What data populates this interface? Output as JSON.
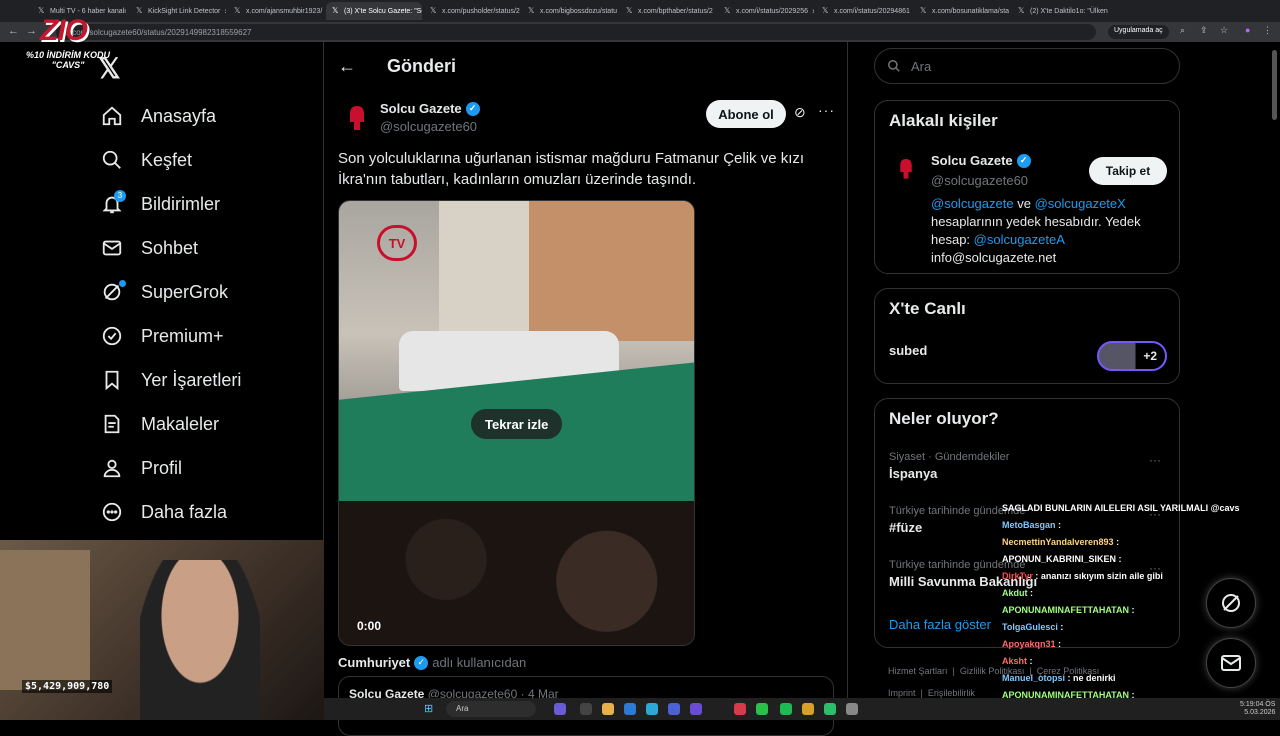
{
  "browser": {
    "tabs": [
      {
        "label": "Multi TV - 6 haber kanalı"
      },
      {
        "label": "KickSight Link Detector"
      },
      {
        "label": "x.com/ajansmuhbir1923/"
      },
      {
        "label": "(3) X'te Solcu Gazete: \"So"
      },
      {
        "label": "x.com/pusholder/status/2"
      },
      {
        "label": "x.com/bigbossdozu/statu"
      },
      {
        "label": "x.com/bpthaber/status/2"
      },
      {
        "label": "x.com/i/status/2029256"
      },
      {
        "label": "x.com/i/status/20294861"
      },
      {
        "label": "x.com/bosunatiklama/sta"
      },
      {
        "label": "(2) X'te Daktilo1o: \"Ülken"
      }
    ],
    "url": "x.com/solcugazete60/status/2029149982318559627",
    "pill": "Uygulamada aç"
  },
  "overlay": {
    "logo": "ZIO",
    "promo_line1": "%10 İNDİRİM KODU",
    "promo_line2": "\"CAVS\"",
    "money": "$5,429,909,780"
  },
  "sidebar": {
    "items": [
      {
        "label": "Anasayfa",
        "icon": "home-icon"
      },
      {
        "label": "Keşfet",
        "icon": "search-icon"
      },
      {
        "label": "Bildirimler",
        "icon": "bell-icon",
        "badge": "3"
      },
      {
        "label": "Sohbet",
        "icon": "mail-icon"
      },
      {
        "label": "SuperGrok",
        "icon": "grok-icon"
      },
      {
        "label": "Premium+",
        "icon": "verified-badge-icon"
      },
      {
        "label": "Yer İşaretleri",
        "icon": "bookmark-icon"
      },
      {
        "label": "Makaleler",
        "icon": "article-icon"
      },
      {
        "label": "Profil",
        "icon": "person-icon"
      },
      {
        "label": "Daha fazla",
        "icon": "more-circle-icon"
      }
    ]
  },
  "main": {
    "title": "Gönderi",
    "post": {
      "author": "Solcu Gazete",
      "handle": "@solcugazete60",
      "subscribe": "Abone ol",
      "text": "Son yolculuklarına uğurlanan istismar mağduru Fatmanur Çelik ve kızı İkra'nın tabutları, kadınların omuzları üzerinde taşındı.",
      "video": {
        "replay": "Tekrar izle",
        "time": "0:00",
        "channel_logo": "TV"
      },
      "quoted_by_name": "Cumhuriyet",
      "quoted_by_suffix": "adlı kullanıcıdan",
      "quote_author": "Solcu Gazete",
      "quote_handle": "@solcugazete60",
      "quote_date": "· 4 Mar"
    }
  },
  "right": {
    "search_placeholder": "Ara",
    "related": {
      "title": "Alakalı kişiler",
      "name": "Solcu Gazete",
      "handle": "@solcugazete60",
      "follow": "Takip et",
      "mention1": "@solcugazete",
      "and": "ve",
      "mention2": "@solcugazeteX",
      "bio1": "hesaplarının yedek hesabıdır. Yedek",
      "bio2": "hesap:",
      "mention3": "@solcugazeteA",
      "email": "info@solcugazete.net"
    },
    "live": {
      "title": "X'te Canlı",
      "name": "subed",
      "count": "+2"
    },
    "trends": {
      "title": "Neler oluyor?",
      "items": [
        {
          "meta": "Siyaset · Gündemdekiler",
          "name": "İspanya"
        },
        {
          "meta": "Türkiye tarihinde gündemde",
          "name": "#füze"
        },
        {
          "meta": "Türkiye tarihinde gündemde",
          "name": "Milli Savunma Bakanlığı"
        }
      ],
      "more": "Daha fazla göster"
    },
    "footer": [
      "Hizmet Şartları",
      "Gizlilik Politikası",
      "Çerez Politikası",
      "Imprint",
      "Erişilebilirlik"
    ]
  },
  "chat": [
    {
      "user": "",
      "msg": "SAGLADI BUNLARIN AILELERI ASIL YARILMALI @cavs",
      "color": "#ffffff"
    },
    {
      "user": "MetoBasgan",
      "msg": "",
      "color": "#7fc7ff"
    },
    {
      "user": "NecmettinYandalveren893",
      "msg": "",
      "color": "#ffd27f"
    },
    {
      "user": "APONUN_KABRINI_SIKEN",
      "msg": "",
      "color": "#ffffff"
    },
    {
      "user": "DirkTyr",
      "msg": "ananızı sıkıyım sizin aile gibi",
      "color": "#ff4d4d"
    },
    {
      "user": "Akdut",
      "msg": "",
      "color": "#a0ff7f"
    },
    {
      "user": "APONUNAMINAFETTAHATAN",
      "msg": "",
      "color": "#a0ff7f"
    },
    {
      "user": "TolgaGulesci",
      "msg": "",
      "color": "#7fc7ff"
    },
    {
      "user": "Apoyakqn31",
      "msg": "",
      "color": "#ff6b6b"
    },
    {
      "user": "Aksht",
      "msg": "",
      "color": "#ff6b6b"
    },
    {
      "user": "Manuel_otopsi",
      "msg": "ne denirki",
      "color": "#7fc7ff"
    },
    {
      "user": "APONUNAMINAFETTAHATAN",
      "msg": "",
      "color": "#a0ff7f"
    },
    {
      "user": "MetoBasgan",
      "msg": "",
      "color": "#7fc7ff"
    }
  ],
  "taskbar": {
    "search": "Ara",
    "time": "5:19:04 ÖS",
    "date": "5.03.2026"
  },
  "colors": {
    "accent": "#1d9bf0",
    "bg": "#000000",
    "border": "#2f3336"
  }
}
